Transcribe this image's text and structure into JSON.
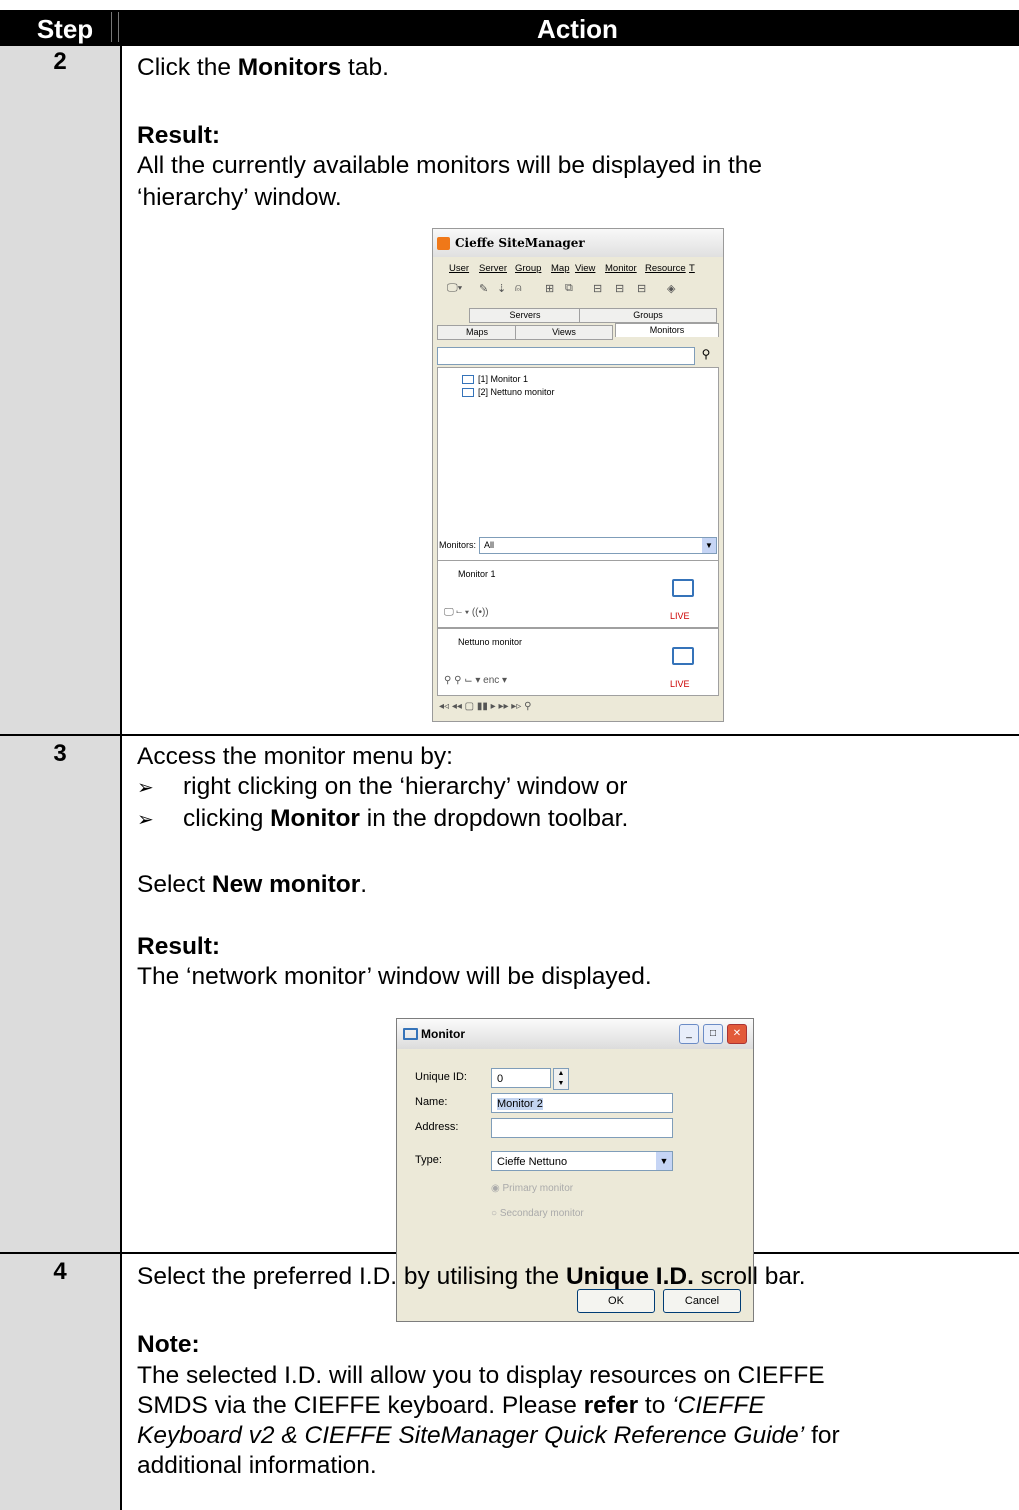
{
  "table": {
    "header_step": "Step",
    "header_action": "Action"
  },
  "rows": [
    {
      "step": "2",
      "line1_pre": "Click the ",
      "line1_bold": "Monitors",
      "line1_post": " tab.",
      "result_label": "Result:",
      "result_line1": "All the currently available monitors will be displayed in the",
      "result_line2": "‘hierarchy’ window."
    },
    {
      "step": "3",
      "intro": "Access the monitor menu by:",
      "bullet1": "right clicking on the ‘hierarchy’ window or",
      "bullet2_pre": "clicking ",
      "bullet2_bold": "Monitor",
      "bullet2_post": " in the dropdown toolbar.",
      "select_pre": "Select ",
      "select_bold": "New monitor",
      "select_post": ".",
      "result_label": "Result:",
      "result_line1": "The ‘network monitor’ window will be displayed."
    },
    {
      "step": "4",
      "line1_pre": "Select the preferred I.D. by utilising the ",
      "line1_bold": "Unique I.D.",
      "line1_post": " scroll bar.",
      "note_label": "Note:",
      "note_line1": "The selected I.D. will allow you to display resources on CIEFFE",
      "note_line2_pre": "SMDS via the CIEFFE keyboard.  Please ",
      "note_line2_bold": "refer",
      "note_line2_mid": " to ",
      "note_line2_ital": "‘CIEFFE",
      "note_line3_ital": "Keyboard v2 & CIEFFE SiteManager Quick Reference Guide’",
      "note_line3_post": " for",
      "note_line4": "additional information."
    }
  ],
  "sitemanager": {
    "title": "Cieffe SiteManager",
    "menu": [
      "User",
      "Server",
      "Group",
      "Map",
      "View",
      "Monitor",
      "Resource",
      "T"
    ],
    "tabs_row1": [
      "Servers",
      "Groups"
    ],
    "tabs_row2": [
      "Maps",
      "Views",
      "Monitors"
    ],
    "tree": [
      "[1] Monitor 1",
      "[2] Nettuno monitor"
    ],
    "monitors_label": "Monitors:",
    "monitors_value": "All",
    "cards": [
      {
        "name": "Monitor 1",
        "status": "LIVE",
        "icons": "🖵 ⌙ ▾ ((•))"
      },
      {
        "name": "Nettuno monitor",
        "status": "LIVE",
        "icons": "⚲ ⚲ ⌙ ▾ enc ▾"
      }
    ],
    "bottombar": "◂◃ ◂◂ ▢ ▮▮ ▸ ▸▸ ▸▹  ⚲"
  },
  "monitor_dialog": {
    "title": "Monitor",
    "unique_id_label": "Unique ID:",
    "unique_id_value": "0",
    "name_label": "Name:",
    "name_value": "Monitor 2",
    "address_label": "Address:",
    "address_value": "",
    "type_label": "Type:",
    "type_value": "Cieffe Nettuno",
    "radio1": "Primary monitor",
    "radio2": "Secondary monitor",
    "ok": "OK",
    "cancel": "Cancel"
  }
}
